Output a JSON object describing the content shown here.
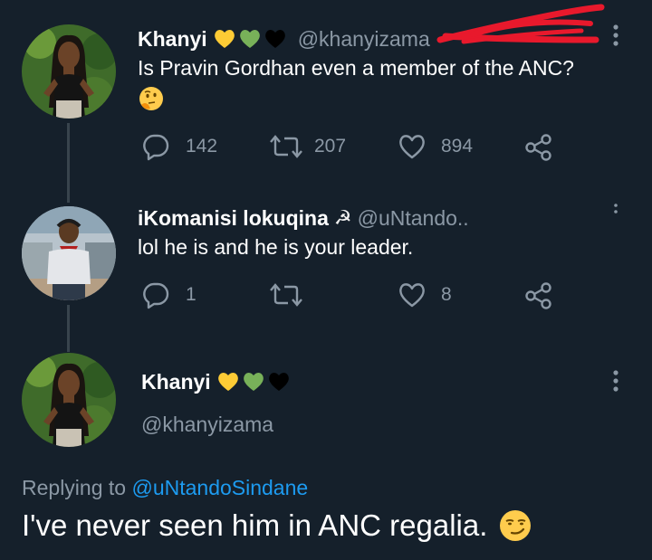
{
  "tweets": [
    {
      "name": "Khanyi",
      "name_emojis": [
        "yellow-heart",
        "green-heart",
        "black-heart"
      ],
      "handle": "@khanyizama",
      "text": "Is Pravin Gordhan even a member of the ANC?",
      "text_emoji": "thinking-face",
      "actions": {
        "replies": "142",
        "retweets": "207",
        "likes": "894"
      }
    },
    {
      "name": "iKomanisi lokuqina",
      "name_emoji": "hammer-and-sickle",
      "name_symbol": "☭",
      "handle": "@uNtando..",
      "text": "lol he is and he is your leader.",
      "actions": {
        "replies": "1",
        "retweets": "",
        "likes": "8"
      }
    }
  ],
  "main_tweet": {
    "name": "Khanyi",
    "name_emojis": [
      "yellow-heart",
      "green-heart",
      "black-heart"
    ],
    "handle": "@khanyizama",
    "replying_label": "Replying to",
    "replying_to": "@uNtandoSindane",
    "text": "I've never seen him in ANC regalia.",
    "text_emoji": "smirking-face"
  },
  "colors": {
    "background": "#15202b",
    "text": "#ffffff",
    "muted": "#8b98a5",
    "link": "#1d9bf0",
    "scribble": "#e8192c"
  }
}
